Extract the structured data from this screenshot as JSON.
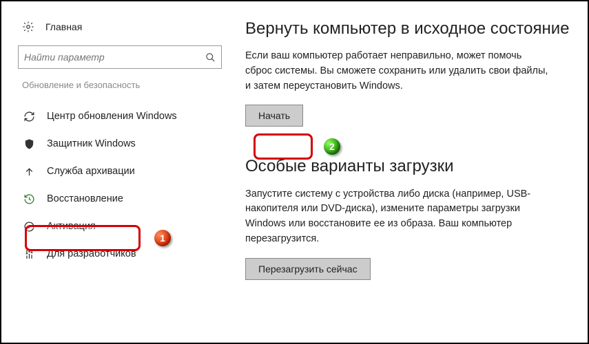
{
  "sidebar": {
    "home": "Главная",
    "search_placeholder": "Найти параметр",
    "section_label": "Обновление и безопасность",
    "items": [
      {
        "label": "Центр обновления Windows"
      },
      {
        "label": "Защитник Windows"
      },
      {
        "label": "Служба архивации"
      },
      {
        "label": "Восстановление"
      },
      {
        "label": "Активация"
      },
      {
        "label": "Для разработчиков"
      }
    ]
  },
  "main": {
    "reset": {
      "title": "Вернуть компьютер в исходное состояние",
      "desc": "Если ваш компьютер работает неправильно, может помочь сброс системы. Вы сможете сохранить или удалить свои файлы, и затем переустановить Windows.",
      "button": "Начать"
    },
    "advanced": {
      "title": "Особые варианты загрузки",
      "desc": "Запустите систему с устройства либо диска (например, USB-накопителя или DVD-диска), измените параметры загрузки Windows или восстановите ее из образа. Ваш компьютер перезагрузится.",
      "button": "Перезагрузить сейчас"
    }
  },
  "annotations": {
    "badge1": "1",
    "badge2": "2"
  }
}
